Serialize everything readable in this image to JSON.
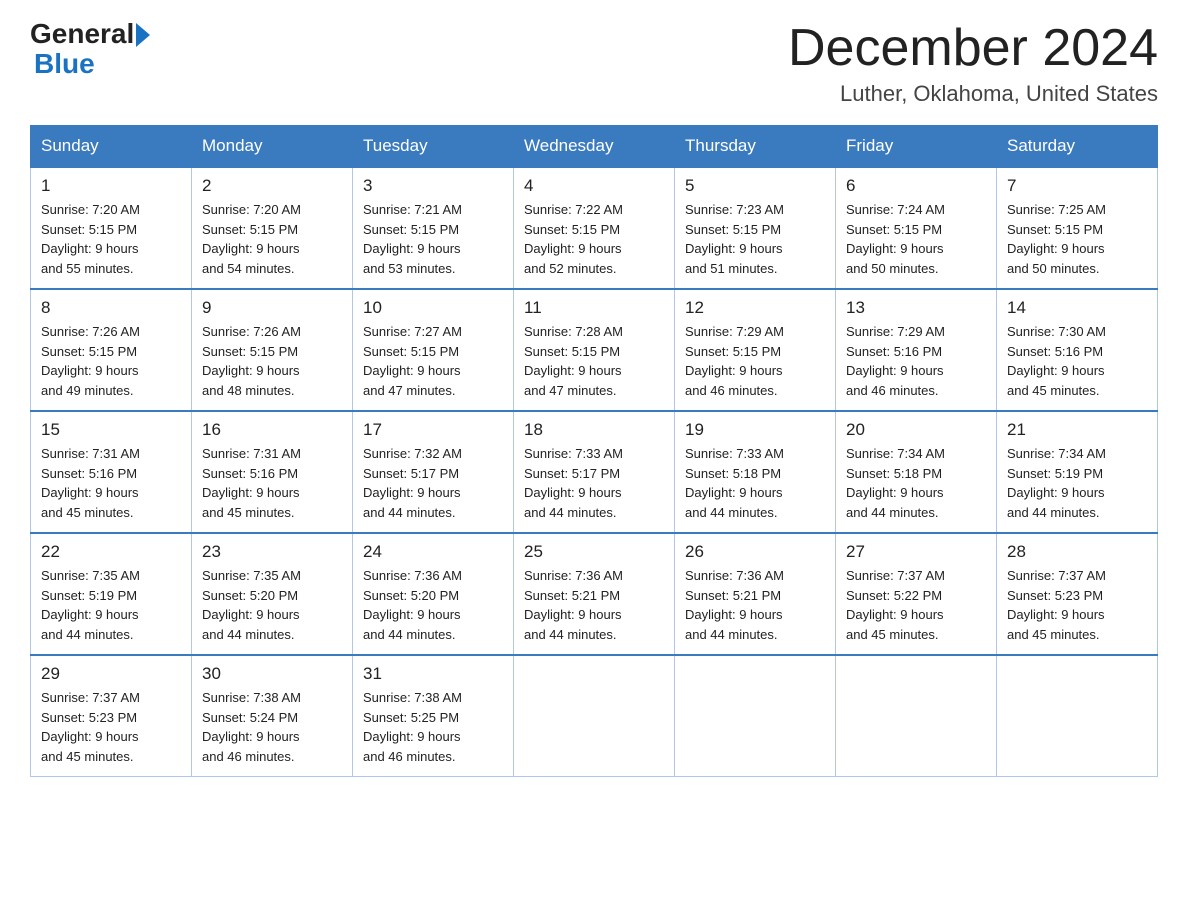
{
  "header": {
    "logo_general": "General",
    "logo_blue": "Blue",
    "month_year": "December 2024",
    "location": "Luther, Oklahoma, United States"
  },
  "days_of_week": [
    "Sunday",
    "Monday",
    "Tuesday",
    "Wednesday",
    "Thursday",
    "Friday",
    "Saturday"
  ],
  "weeks": [
    [
      {
        "day": "1",
        "sunrise": "7:20 AM",
        "sunset": "5:15 PM",
        "daylight": "9 hours and 55 minutes."
      },
      {
        "day": "2",
        "sunrise": "7:20 AM",
        "sunset": "5:15 PM",
        "daylight": "9 hours and 54 minutes."
      },
      {
        "day": "3",
        "sunrise": "7:21 AM",
        "sunset": "5:15 PM",
        "daylight": "9 hours and 53 minutes."
      },
      {
        "day": "4",
        "sunrise": "7:22 AM",
        "sunset": "5:15 PM",
        "daylight": "9 hours and 52 minutes."
      },
      {
        "day": "5",
        "sunrise": "7:23 AM",
        "sunset": "5:15 PM",
        "daylight": "9 hours and 51 minutes."
      },
      {
        "day": "6",
        "sunrise": "7:24 AM",
        "sunset": "5:15 PM",
        "daylight": "9 hours and 50 minutes."
      },
      {
        "day": "7",
        "sunrise": "7:25 AM",
        "sunset": "5:15 PM",
        "daylight": "9 hours and 50 minutes."
      }
    ],
    [
      {
        "day": "8",
        "sunrise": "7:26 AM",
        "sunset": "5:15 PM",
        "daylight": "9 hours and 49 minutes."
      },
      {
        "day": "9",
        "sunrise": "7:26 AM",
        "sunset": "5:15 PM",
        "daylight": "9 hours and 48 minutes."
      },
      {
        "day": "10",
        "sunrise": "7:27 AM",
        "sunset": "5:15 PM",
        "daylight": "9 hours and 47 minutes."
      },
      {
        "day": "11",
        "sunrise": "7:28 AM",
        "sunset": "5:15 PM",
        "daylight": "9 hours and 47 minutes."
      },
      {
        "day": "12",
        "sunrise": "7:29 AM",
        "sunset": "5:15 PM",
        "daylight": "9 hours and 46 minutes."
      },
      {
        "day": "13",
        "sunrise": "7:29 AM",
        "sunset": "5:16 PM",
        "daylight": "9 hours and 46 minutes."
      },
      {
        "day": "14",
        "sunrise": "7:30 AM",
        "sunset": "5:16 PM",
        "daylight": "9 hours and 45 minutes."
      }
    ],
    [
      {
        "day": "15",
        "sunrise": "7:31 AM",
        "sunset": "5:16 PM",
        "daylight": "9 hours and 45 minutes."
      },
      {
        "day": "16",
        "sunrise": "7:31 AM",
        "sunset": "5:16 PM",
        "daylight": "9 hours and 45 minutes."
      },
      {
        "day": "17",
        "sunrise": "7:32 AM",
        "sunset": "5:17 PM",
        "daylight": "9 hours and 44 minutes."
      },
      {
        "day": "18",
        "sunrise": "7:33 AM",
        "sunset": "5:17 PM",
        "daylight": "9 hours and 44 minutes."
      },
      {
        "day": "19",
        "sunrise": "7:33 AM",
        "sunset": "5:18 PM",
        "daylight": "9 hours and 44 minutes."
      },
      {
        "day": "20",
        "sunrise": "7:34 AM",
        "sunset": "5:18 PM",
        "daylight": "9 hours and 44 minutes."
      },
      {
        "day": "21",
        "sunrise": "7:34 AM",
        "sunset": "5:19 PM",
        "daylight": "9 hours and 44 minutes."
      }
    ],
    [
      {
        "day": "22",
        "sunrise": "7:35 AM",
        "sunset": "5:19 PM",
        "daylight": "9 hours and 44 minutes."
      },
      {
        "day": "23",
        "sunrise": "7:35 AM",
        "sunset": "5:20 PM",
        "daylight": "9 hours and 44 minutes."
      },
      {
        "day": "24",
        "sunrise": "7:36 AM",
        "sunset": "5:20 PM",
        "daylight": "9 hours and 44 minutes."
      },
      {
        "day": "25",
        "sunrise": "7:36 AM",
        "sunset": "5:21 PM",
        "daylight": "9 hours and 44 minutes."
      },
      {
        "day": "26",
        "sunrise": "7:36 AM",
        "sunset": "5:21 PM",
        "daylight": "9 hours and 44 minutes."
      },
      {
        "day": "27",
        "sunrise": "7:37 AM",
        "sunset": "5:22 PM",
        "daylight": "9 hours and 45 minutes."
      },
      {
        "day": "28",
        "sunrise": "7:37 AM",
        "sunset": "5:23 PM",
        "daylight": "9 hours and 45 minutes."
      }
    ],
    [
      {
        "day": "29",
        "sunrise": "7:37 AM",
        "sunset": "5:23 PM",
        "daylight": "9 hours and 45 minutes."
      },
      {
        "day": "30",
        "sunrise": "7:38 AM",
        "sunset": "5:24 PM",
        "daylight": "9 hours and 46 minutes."
      },
      {
        "day": "31",
        "sunrise": "7:38 AM",
        "sunset": "5:25 PM",
        "daylight": "9 hours and 46 minutes."
      },
      null,
      null,
      null,
      null
    ]
  ],
  "labels": {
    "sunrise": "Sunrise:",
    "sunset": "Sunset:",
    "daylight": "Daylight:"
  }
}
